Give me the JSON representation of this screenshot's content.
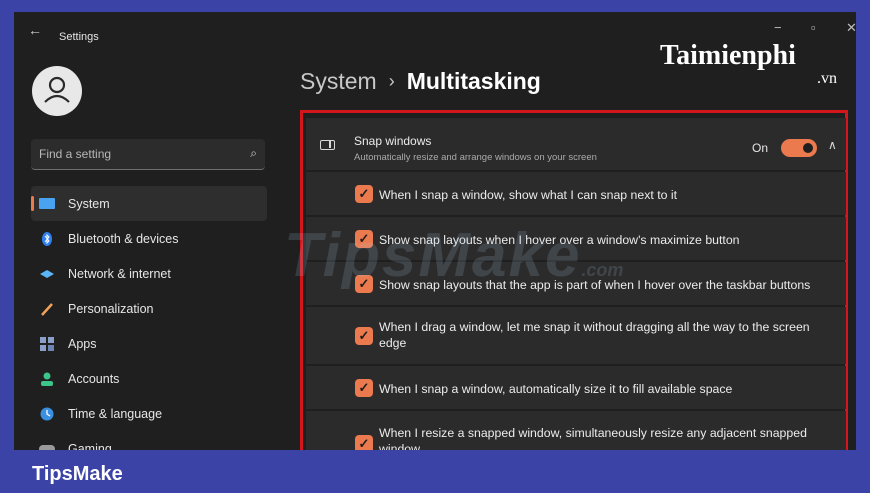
{
  "window": {
    "title": "Settings",
    "back_icon": "back-arrow-icon"
  },
  "brand_logo": {
    "text": "Taimienphi",
    "suffix": ".vn"
  },
  "watermark": {
    "text": "TipsMake",
    "suffix": ".com"
  },
  "search": {
    "placeholder": "Find a setting",
    "icon": "search-icon"
  },
  "sidebar": {
    "items": [
      {
        "label": "System",
        "icon": "system-icon",
        "active": true
      },
      {
        "label": "Bluetooth & devices",
        "icon": "bluetooth-icon"
      },
      {
        "label": "Network & internet",
        "icon": "network-icon"
      },
      {
        "label": "Personalization",
        "icon": "personalization-icon"
      },
      {
        "label": "Apps",
        "icon": "apps-icon"
      },
      {
        "label": "Accounts",
        "icon": "accounts-icon"
      },
      {
        "label": "Time & language",
        "icon": "time-language-icon"
      },
      {
        "label": "Gaming",
        "icon": "gaming-icon"
      }
    ]
  },
  "breadcrumb": {
    "parent": "System",
    "separator": "›",
    "current": "Multitasking"
  },
  "snap": {
    "title": "Snap windows",
    "description": "Automatically resize and arrange windows on your screen",
    "toggle_label": "On",
    "toggle_on": true,
    "options": [
      {
        "label": "When I snap a window, show what I can snap next to it",
        "checked": true
      },
      {
        "label": "Show snap layouts when I hover over a window's maximize button",
        "checked": true
      },
      {
        "label": "Show snap layouts that the app is part of when I hover over the taskbar buttons",
        "checked": true
      },
      {
        "label": "When I drag a window, let me snap it without dragging all the way to the screen edge",
        "checked": true
      },
      {
        "label": "When I snap a window, automatically size it to fill available space",
        "checked": true
      },
      {
        "label": "When I resize a snapped window, simultaneously resize any adjacent snapped window",
        "checked": true
      }
    ]
  },
  "footer": {
    "label": "TipsMake"
  },
  "colors": {
    "accent": "#ec7a4f",
    "highlight_border": "#d3161c",
    "frame_bg": "#3b44a6",
    "window_bg": "#1f1f1f"
  }
}
